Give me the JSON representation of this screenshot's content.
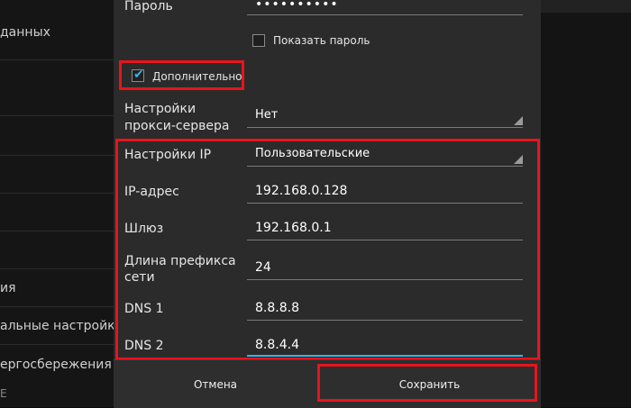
{
  "background_list": {
    "items": [
      {
        "label": "данных"
      },
      {
        "label": "ия"
      },
      {
        "label": "альные настройки"
      },
      {
        "label": "ергосбережения"
      },
      {
        "label": "E"
      }
    ]
  },
  "dialog": {
    "password": {
      "label": "Пароль",
      "value": "••••••••••"
    },
    "show_password": {
      "label": "Показать пароль",
      "checked": false
    },
    "advanced": {
      "label": "Дополнительно",
      "checked": true
    },
    "proxy": {
      "label_line1": "Настройки",
      "label_line2": "прокси-сервера",
      "value": "Нет"
    },
    "ip_settings": {
      "label": "Настройки IP",
      "value": "Пользовательские"
    },
    "ip_address": {
      "label": "IP-адрес",
      "value": "192.168.0.128"
    },
    "gateway": {
      "label": "Шлюз",
      "value": "192.168.0.1"
    },
    "prefix": {
      "label_line1": "Длина префикса",
      "label_line2": "сети",
      "value": "24"
    },
    "dns1": {
      "label": "DNS 1",
      "value": "8.8.8.8"
    },
    "dns2": {
      "label": "DNS 2",
      "value": "8.8.4.4"
    },
    "buttons": {
      "cancel": "Отмена",
      "save": "Сохранить"
    }
  },
  "colors": {
    "highlight_red": "#e8141c",
    "accent_blue": "#33b5e5",
    "dialog_bg": "#2b2b2b"
  }
}
